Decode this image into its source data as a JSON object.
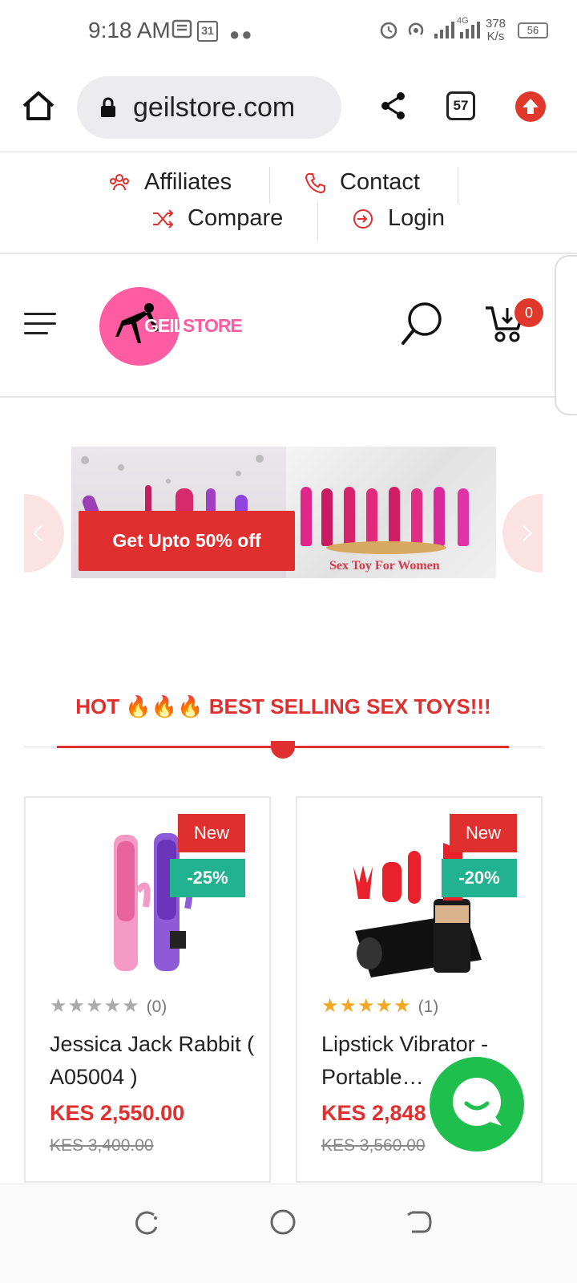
{
  "status": {
    "time": "9:18 AM",
    "calendar_day": "31",
    "net_speed_value": "378",
    "net_speed_unit": "K/s",
    "network_type": "4G",
    "battery": "56"
  },
  "browser": {
    "url": "geilstore.com",
    "tab_count": "57"
  },
  "toplinks": {
    "affiliates": "Affiliates",
    "contact": "Contact",
    "compare": "Compare",
    "login": "Login"
  },
  "header": {
    "logo_word1": "GEIL",
    "logo_word2": "STORE",
    "cart_count": "0"
  },
  "banner": {
    "offer_label": "Get Upto 50% off",
    "caption": "Sex Toy For Women"
  },
  "section": {
    "title": "HOT 🔥🔥🔥 BEST SELLING SEX TOYS!!!"
  },
  "products": [
    {
      "badge_new": "New",
      "discount": "-25%",
      "stars_filled": "",
      "stars_empty": "★★★★★",
      "rating_count": "(0)",
      "name": "Jessica Jack Rabbit ( A05004 )",
      "price": "KES 2,550.00",
      "old_price": "KES 3,400.00"
    },
    {
      "badge_new": "New",
      "discount": "-20%",
      "stars_filled": "★★★★★",
      "stars_empty": "",
      "rating_count": "(1)",
      "name": "Lipstick Vibrator - Portable…",
      "price": "KES 2,848",
      "old_price": "KES 3,560.00"
    }
  ],
  "colors": {
    "accent_red": "#e02f2f",
    "discount_green": "#21b38f",
    "logo_pink": "#ff5ca2",
    "chat_green": "#1fbf4e"
  }
}
